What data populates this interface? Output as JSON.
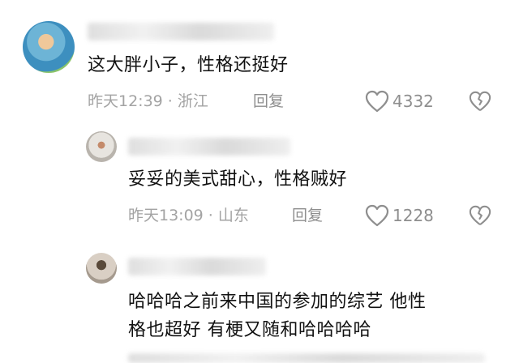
{
  "comments": [
    {
      "text": "这大胖小子，性格还挺好",
      "time": "昨天12:39",
      "location": "浙江",
      "reply": "回复",
      "likes": "4332",
      "separator": "·"
    },
    {
      "text": "妥妥的美式甜心，性格贼好",
      "time": "昨天13:09",
      "location": "山东",
      "reply": "回复",
      "likes": "1228",
      "separator": "·"
    },
    {
      "text_line1": "哈哈哈之前来中国的参加的综艺 他性",
      "text_line2": "格也超好 有梗又随和哈哈哈哈"
    }
  ],
  "icons": {
    "like": "heart-outline-icon",
    "dislike": "broken-heart-icon"
  },
  "colors": {
    "meta": "#a3a3a3",
    "text": "#111111",
    "icon": "#8e8e8e"
  }
}
